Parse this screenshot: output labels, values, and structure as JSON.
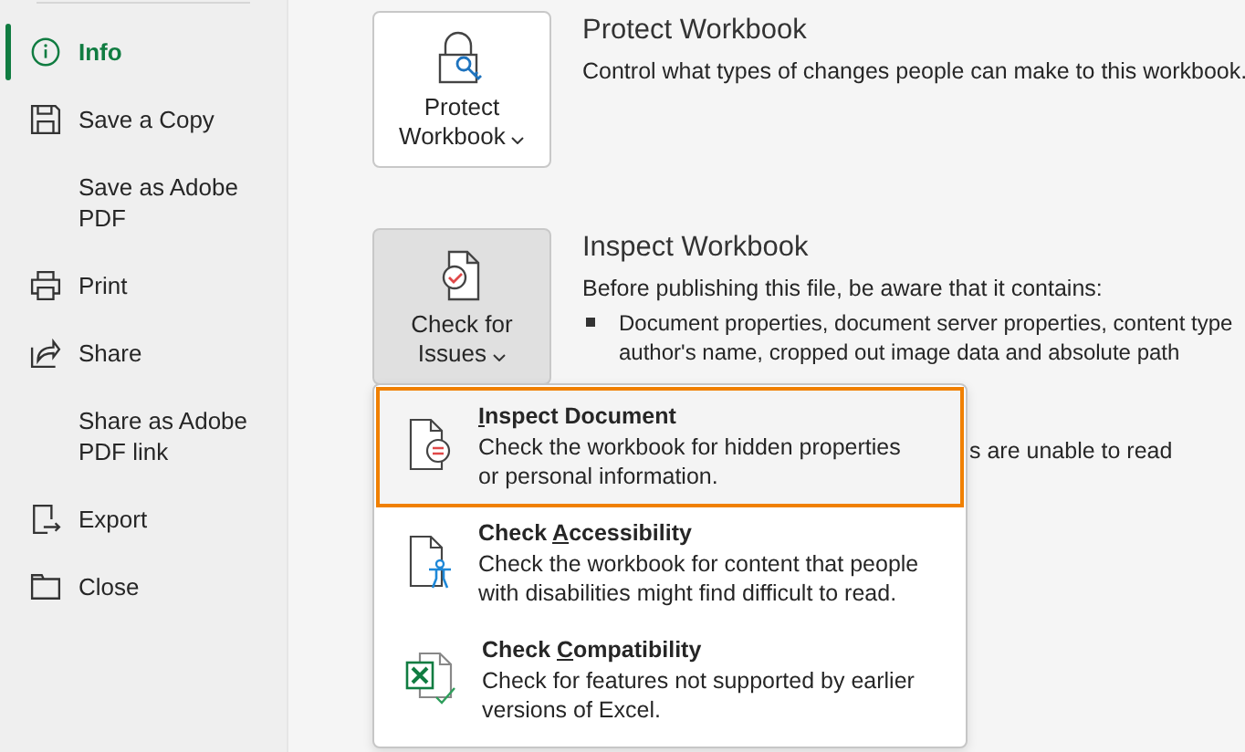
{
  "sidebar": {
    "items": [
      {
        "label": "Info",
        "selected": true
      },
      {
        "label": "Save a Copy",
        "selected": false
      },
      {
        "label": "Save as Adobe PDF",
        "selected": false
      },
      {
        "label": "Print",
        "selected": false
      },
      {
        "label": "Share",
        "selected": false
      },
      {
        "label": "Share as Adobe PDF link",
        "selected": false
      },
      {
        "label": "Export",
        "selected": false
      },
      {
        "label": "Close",
        "selected": false
      }
    ]
  },
  "sections": [
    {
      "button": {
        "lines": [
          "Protect",
          "Workbook"
        ],
        "pressed": false
      },
      "title": "Protect Workbook",
      "description": "Control what types of changes people can make to this workbook."
    },
    {
      "button": {
        "lines": [
          "Check for",
          "Issues"
        ],
        "pressed": true
      },
      "title": "Inspect Workbook",
      "description": "Before publishing this file, be aware that it contains:",
      "bullets": [
        {
          "lines": [
            "Document properties, document server properties, content type",
            "author's name, cropped out image data and absolute path"
          ]
        }
      ],
      "covered_fragment": "s are unable to read"
    }
  ],
  "menu": {
    "items": [
      {
        "title": "Inspect Document",
        "description": [
          "Check the workbook for hidden properties",
          "or personal information."
        ],
        "selected": true
      },
      {
        "title": "Check Accessibility",
        "description": [
          "Check the workbook for content that people",
          "with disabilities might find difficult to read."
        ],
        "selected": false
      },
      {
        "title": "Check Compatibility",
        "description": [
          "Check for features not supported by earlier",
          "versions of Excel."
        ],
        "selected": false
      }
    ]
  }
}
